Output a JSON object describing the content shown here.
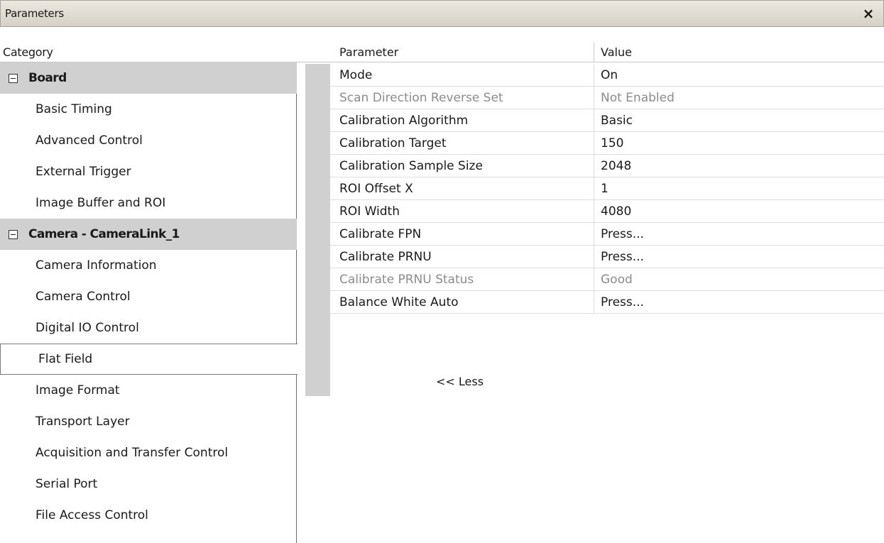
{
  "window": {
    "title": "Parameters",
    "close_icon": "×"
  },
  "header": {
    "category": "Category",
    "parameter": "Parameter",
    "value": "Value"
  },
  "categories": [
    {
      "label": "Board",
      "type": "group"
    },
    {
      "label": "Basic Timing",
      "type": "item"
    },
    {
      "label": "Advanced Control",
      "type": "item"
    },
    {
      "label": "External Trigger",
      "type": "item"
    },
    {
      "label": "Image Buffer and ROI",
      "type": "item"
    },
    {
      "label": "Camera - CameraLink_1",
      "type": "group"
    },
    {
      "label": "Camera Information",
      "type": "item"
    },
    {
      "label": "Camera Control",
      "type": "item"
    },
    {
      "label": "Digital IO Control",
      "type": "item"
    },
    {
      "label": "Flat Field",
      "type": "item",
      "selected": true
    },
    {
      "label": "Image Format",
      "type": "item"
    },
    {
      "label": "Transport Layer",
      "type": "item"
    },
    {
      "label": "Acquisition and Transfer Control",
      "type": "item"
    },
    {
      "label": "Serial Port",
      "type": "item"
    },
    {
      "label": "File Access Control",
      "type": "item"
    }
  ],
  "parameters": [
    {
      "name": "Mode",
      "value": "On",
      "enabled": true
    },
    {
      "name": "Scan Direction Reverse Set",
      "value": "Not Enabled",
      "enabled": false
    },
    {
      "name": "Calibration Algorithm",
      "value": "Basic",
      "enabled": true
    },
    {
      "name": "Calibration Target",
      "value": "150",
      "enabled": true
    },
    {
      "name": "Calibration Sample Size",
      "value": "2048",
      "enabled": true
    },
    {
      "name": "ROI Offset X",
      "value": "1",
      "enabled": true
    },
    {
      "name": "ROI Width",
      "value": "4080",
      "enabled": true
    },
    {
      "name": "Calibrate FPN",
      "value": "Press...",
      "enabled": true
    },
    {
      "name": "Calibrate PRNU",
      "value": "Press...",
      "enabled": true
    },
    {
      "name": "Calibrate PRNU Status",
      "value": "Good",
      "enabled": false
    },
    {
      "name": "Balance White Auto",
      "value": "Press...",
      "enabled": true
    }
  ],
  "less_label": "<< Less"
}
